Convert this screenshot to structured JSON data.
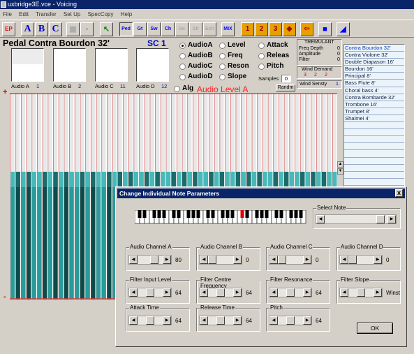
{
  "window": {
    "title": "uxbridge3E.vce - Voicing"
  },
  "menu": [
    "File",
    "Edit",
    "Transfer",
    "Set Up",
    "SpecCopy",
    "Help"
  ],
  "toolbar": {
    "ep": "EP",
    "a": "A",
    "b": "B",
    "c": "C",
    "ped": "Ped",
    "gt": "Gt",
    "sw": "Sw",
    "ch": "Ch",
    "so": "So",
    "str": "Str",
    "ech": "Ech",
    "mix": "MIX",
    "n1": "1",
    "n2": "2",
    "n3": "3"
  },
  "stop_name": "Pedal Contra Bourdon 32'",
  "sc_label": "SC 1",
  "audio_boxes": [
    {
      "label": "Audio A",
      "num": "1"
    },
    {
      "label": "Audio B",
      "num": "2"
    },
    {
      "label": "Audio C",
      "num": "11"
    },
    {
      "label": "Audio D",
      "num": "12"
    }
  ],
  "radios": {
    "col1": [
      "AudioA",
      "AudioB",
      "AudioC",
      "AudioD"
    ],
    "col2": [
      "Level",
      "Freq",
      "Reson",
      "Slope"
    ],
    "col3": [
      "Attack",
      "Releas",
      "Pitch"
    ]
  },
  "samples_label": "Samples",
  "samples_value": "0",
  "alg_label": "Alg",
  "randm_label": "Randm",
  "audio_level_title": "Audio Level A",
  "tremulant": {
    "title": "TREMULANT",
    "rows": [
      {
        "label": "Freq Depth",
        "value": "0"
      },
      {
        "label": "Amplitude",
        "value": "0"
      },
      {
        "label": "Filter",
        "value": "0"
      }
    ]
  },
  "wind_demand": {
    "title": "Wind Demand",
    "values": [
      "3",
      "2",
      "2"
    ]
  },
  "wind_sensity": {
    "label": "Wind Sensty",
    "value": "1"
  },
  "stops": [
    "Contra Bourdon 32'",
    "Contra Violone 32'",
    "Double Diapason 16'",
    "Bourdon 16'",
    "Principal 8'",
    "Bass Flute 8'",
    "Choral bass 4'",
    "Contra Bombarde 32'",
    "Trombone 16'",
    "Trumpet 8'",
    "Shalmei 4'",
    "",
    "",
    "",
    "",
    "",
    "",
    "",
    "",
    "",
    "",
    "",
    "",
    "",
    "",
    ""
  ],
  "plot_labels": {
    "plus": "+",
    "minus": "-"
  },
  "dialog": {
    "title": "Change Individual Note Parameters",
    "close": "x",
    "select_note": "Select Note",
    "ok": "OK",
    "groups": [
      {
        "label": "Audio Channel A",
        "value": "80",
        "pos": 0.75
      },
      {
        "label": "Audio Channel B",
        "value": "0",
        "pos": 0.0
      },
      {
        "label": "Audio Channel C",
        "value": "0",
        "pos": 0.0
      },
      {
        "label": "Audio Channel D",
        "value": "0",
        "pos": 0.0
      },
      {
        "label": "Filter Input Level",
        "value": "64",
        "pos": 0.5
      },
      {
        "label": "Filter Centre Frequency",
        "value": "64",
        "pos": 0.5
      },
      {
        "label": "Filter Resonance",
        "value": "64",
        "pos": 0.5
      },
      {
        "label": "Filter Slope",
        "value": "Winst",
        "pos": 0.5
      },
      {
        "label": "Attack Time",
        "value": "64",
        "pos": 0.5
      },
      {
        "label": "Release Time",
        "value": "64",
        "pos": 0.5
      },
      {
        "label": "Pitch",
        "value": "64",
        "pos": 0.5
      }
    ]
  }
}
